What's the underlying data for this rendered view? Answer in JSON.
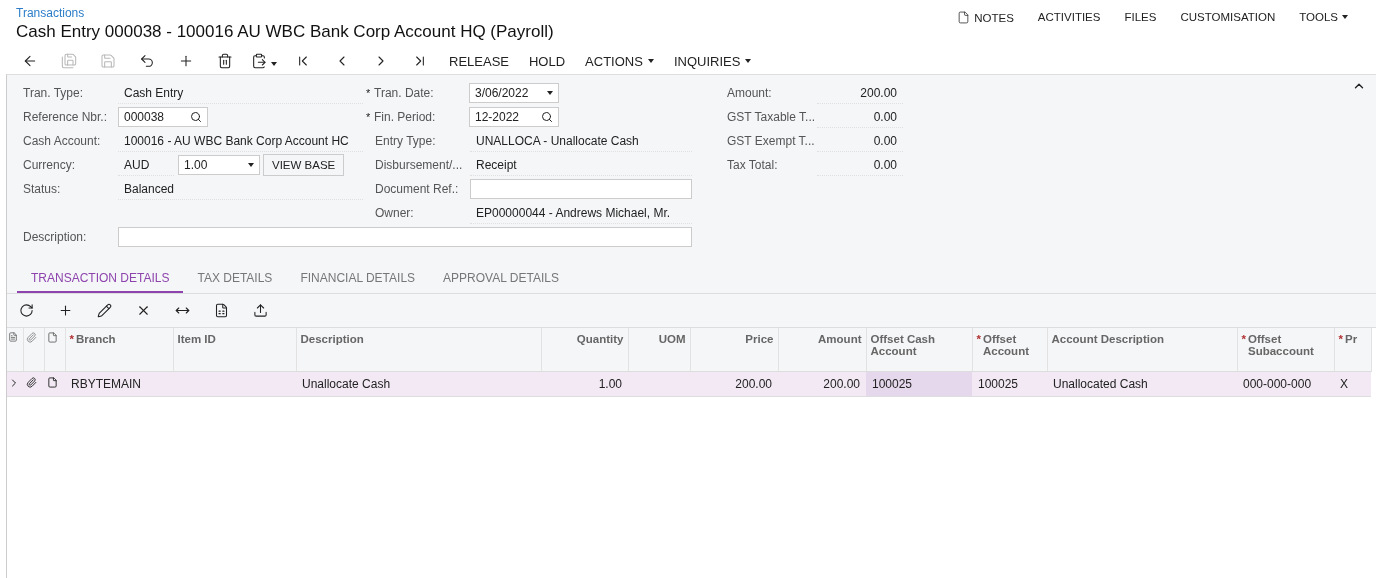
{
  "breadcrumb": "Transactions",
  "title": "Cash Entry 000038 - 100016 AU WBC Bank Corp Account HQ (Payroll)",
  "top_links": [
    {
      "label": "NOTES",
      "kind": "note"
    },
    {
      "label": "ACTIVITIES",
      "kind": "plain"
    },
    {
      "label": "FILES",
      "kind": "plain"
    },
    {
      "label": "CUSTOMISATION",
      "kind": "plain"
    },
    {
      "label": "TOOLS",
      "kind": "menu"
    }
  ],
  "toolbar_icons": [
    {
      "disabled": false
    },
    {
      "disabled": true
    },
    {
      "disabled": true
    },
    {
      "disabled": false
    },
    {
      "disabled": false
    },
    {
      "disabled": false
    },
    {
      "disabled": false
    },
    {
      "disabled": false
    },
    {
      "disabled": false
    },
    {
      "disabled": false
    },
    {
      "disabled": false
    }
  ],
  "toolbar_buttons": [
    {
      "label": "RELEASE",
      "kind": "plain"
    },
    {
      "label": "HOLD",
      "kind": "plain"
    },
    {
      "label": "ACTIONS",
      "kind": "menu"
    },
    {
      "label": "INQUIRIES",
      "kind": "menu"
    }
  ],
  "form": {
    "left": [
      {
        "label": "Tran. Type:",
        "kind": "text",
        "value": "Cash Entry"
      },
      {
        "label": "Reference Nbr.:",
        "kind": "lookup",
        "value": "000038"
      },
      {
        "label": "Cash Account:",
        "kind": "text",
        "value": "100016 - AU WBC Bank Corp Account HC"
      },
      {
        "label": "Currency:",
        "kind": "currency",
        "value": "AUD",
        "rate": "1.00",
        "button": "VIEW BASE"
      },
      {
        "label": "Status:",
        "kind": "text",
        "value": "Balanced"
      }
    ],
    "middle": [
      {
        "label": "Tran. Date:",
        "mark": "*",
        "kind": "date",
        "value": "3/06/2022"
      },
      {
        "label": "Fin. Period:",
        "mark": "*",
        "kind": "lookup",
        "value": "12-2022"
      },
      {
        "label": "Entry Type:",
        "kind": "text",
        "value": "UNALLOCA - Unallocate Cash"
      },
      {
        "label": "Disbursement/...",
        "kind": "text",
        "value": "Receipt"
      },
      {
        "label": "Document Ref.:",
        "kind": "input"
      },
      {
        "label": "Owner:",
        "kind": "text",
        "value": "EP00000044 - Andrews Michael, Mr."
      }
    ],
    "right": [
      {
        "label": "Amount:",
        "value": "200.00"
      },
      {
        "label": "GST Taxable T...",
        "value": "0.00"
      },
      {
        "label": "GST Exempt T...",
        "value": "0.00"
      },
      {
        "label": "Tax Total:",
        "value": "0.00"
      }
    ],
    "description": {
      "label": "Description:"
    }
  },
  "tabs": [
    {
      "label": "TRANSACTION DETAILS",
      "selected": true
    },
    {
      "label": "TAX DETAILS",
      "selected": false
    },
    {
      "label": "FINANCIAL DETAILS",
      "selected": false
    },
    {
      "label": "APPROVAL DETAILS",
      "selected": false
    }
  ],
  "table": {
    "columns": [
      {
        "kind": "selector"
      },
      {
        "kind": "files"
      },
      {
        "kind": "notes"
      },
      {
        "kind": "text",
        "label": "Branch",
        "mark": "*"
      },
      {
        "kind": "text",
        "label": "Item ID"
      },
      {
        "kind": "text",
        "label": "Description"
      },
      {
        "kind": "number",
        "label": "Quantity"
      },
      {
        "kind": "number",
        "label": "UOM"
      },
      {
        "kind": "number",
        "label": "Price"
      },
      {
        "kind": "number",
        "label": "Amount"
      },
      {
        "kind": "text",
        "label": "Offset Cash Account"
      },
      {
        "kind": "text",
        "label": "Offset Account",
        "mark": "*"
      },
      {
        "kind": "text",
        "label": "Account Description"
      },
      {
        "kind": "text",
        "label": "Offset Subaccount",
        "mark": "*"
      },
      {
        "kind": "text",
        "label": "Pr",
        "mark": "*"
      }
    ],
    "rows": [
      {
        "selected": true,
        "cells": [
          {
            "text": "",
            "active": false
          },
          {
            "text": "",
            "active": false
          },
          {
            "text": "",
            "active": false
          },
          {
            "text": "RBYTEMAIN",
            "active": false
          },
          {
            "text": "",
            "active": false
          },
          {
            "text": "Unallocate Cash",
            "active": false
          },
          {
            "text": "1.00",
            "active": false
          },
          {
            "text": "",
            "active": false
          },
          {
            "text": "200.00",
            "active": false
          },
          {
            "text": "200.00",
            "active": false
          },
          {
            "text": "100025",
            "active": true
          },
          {
            "text": "100025",
            "active": false
          },
          {
            "text": "Unallocated Cash",
            "active": false
          },
          {
            "text": "000-000-000",
            "active": false
          },
          {
            "text": "X",
            "active": false
          }
        ]
      }
    ]
  }
}
